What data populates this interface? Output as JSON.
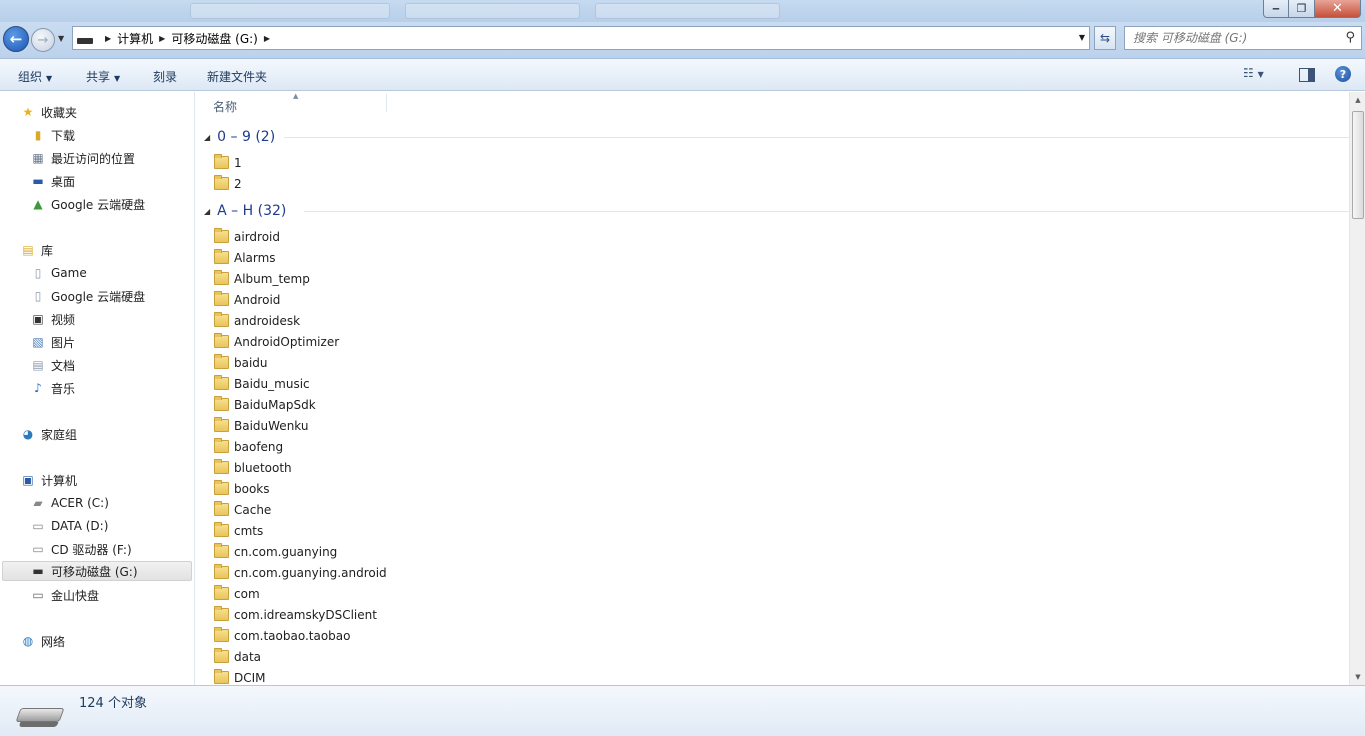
{
  "address": {
    "crumbs": [
      "计算机",
      "可移动磁盘 (G:)"
    ]
  },
  "search": {
    "placeholder": "搜索 可移动磁盘 (G:)"
  },
  "toolbar": {
    "organize": "组织",
    "share": "共享",
    "burn": "刻录",
    "new_folder": "新建文件夹"
  },
  "nav": {
    "favorites": "收藏夹",
    "fav_items": [
      "下载",
      "最近访问的位置",
      "桌面",
      "Google 云端硬盘"
    ],
    "libraries": "库",
    "lib_items": [
      "Game",
      "Google 云端硬盘",
      "视频",
      "图片",
      "文档",
      "音乐"
    ],
    "homegroup": "家庭组",
    "computer": "计算机",
    "drives": [
      "ACER (C:)",
      "DATA (D:)",
      "CD 驱动器 (F:)",
      "可移动磁盘 (G:)",
      "金山快盘"
    ],
    "network": "网络"
  },
  "content": {
    "column_name": "名称",
    "groups": [
      {
        "label": "0 – 9 (2)",
        "items": [
          "1",
          "2"
        ]
      },
      {
        "label": "A – H (32)",
        "items": [
          "airdroid",
          "Alarms",
          "Album_temp",
          "Android",
          "androidesk",
          "AndroidOptimizer",
          "baidu",
          "Baidu_music",
          "BaiduMapSdk",
          "BaiduWenku",
          "baofeng",
          "bluetooth",
          "books",
          "Cache",
          "cmts",
          "cn.com.guanying",
          "cn.com.guanying.android",
          "com",
          "com.idreamskyDSClient",
          "com.taobao.taobao",
          "data",
          "DCIM"
        ]
      }
    ]
  },
  "status": {
    "count": "124 个对象"
  }
}
